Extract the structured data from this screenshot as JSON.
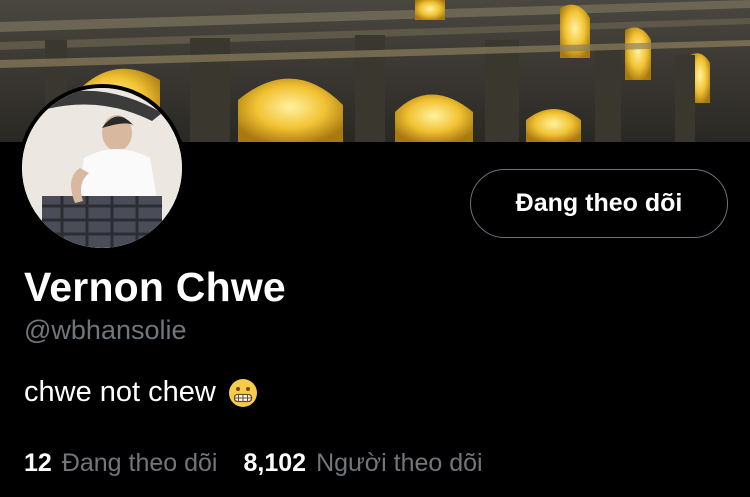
{
  "profile": {
    "display_name": "Vernon Chwe",
    "handle": "@wbhansolie",
    "bio": "chwe not chew",
    "bio_emoji": "grimacing-face-icon",
    "follow_button_label": "Đang theo dõi",
    "stats": {
      "following_count": "12",
      "following_label": "Đang theo dõi",
      "followers_count": "8,102",
      "followers_label": "Người theo dõi"
    }
  },
  "colors": {
    "background": "#000000",
    "muted_text": "#71767b",
    "button_border": "#6a737b",
    "banner_light": "#f2c233"
  }
}
